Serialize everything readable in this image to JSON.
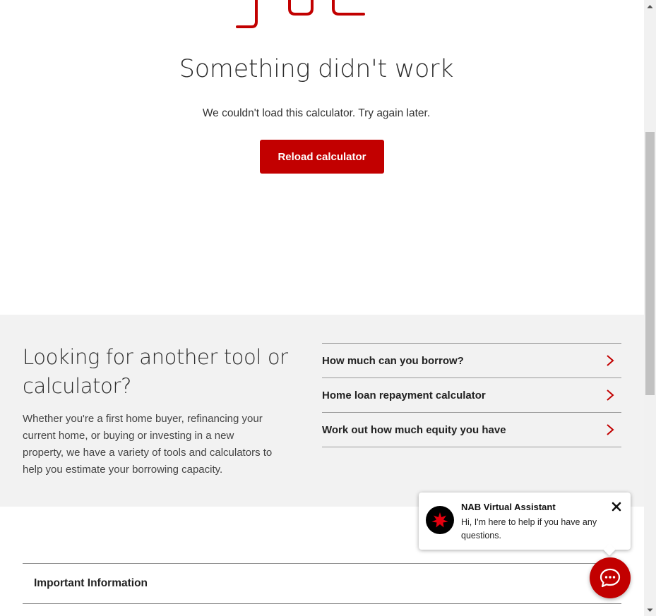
{
  "error": {
    "title": "Something didn't work",
    "subtitle": "We couldn't load this calculator. Try again later.",
    "reload_button": "Reload calculator"
  },
  "tools": {
    "heading": "Looking for another tool or calculator?",
    "description": "Whether you're a first home buyer, refinancing your current home, or buying or investing in a new property, we have a variety of tools and calculators to help you estimate your borrowing capacity.",
    "links": [
      {
        "label": "How much can you borrow?"
      },
      {
        "label": "Home loan repayment calculator"
      },
      {
        "label": "Work out how much equity you have"
      }
    ]
  },
  "important": {
    "label": "Important Information"
  },
  "chat": {
    "name": "NAB Virtual Assistant",
    "message": "Hi, I'm here to help if you have any questions.",
    "icons": {
      "avatar": "nab-star-icon",
      "close": "close-icon",
      "launcher": "chat-bubble-icon"
    }
  },
  "colors": {
    "brand_red": "#c20000",
    "section_bg": "#f2f2f2"
  }
}
